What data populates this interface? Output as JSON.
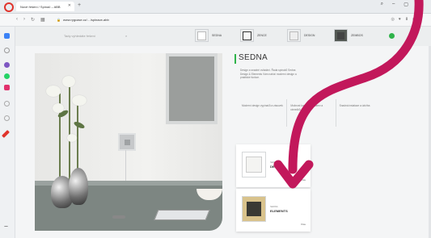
{
  "browser": {
    "tab_title": "Nové řešení / Spínač – ABB",
    "url": "www.rygcase.cz/…/spinace-abb",
    "colors": {
      "opera": "#e0342c"
    }
  },
  "site": {
    "search_placeholder": "Tady vyhledáte řešení",
    "products": [
      {
        "label": "SEDNA",
        "color": "#ffffff"
      },
      {
        "label": "ZENCE",
        "color": "#e6e6e6"
      },
      {
        "label": "DESIGN",
        "color": "#dcdcdc"
      },
      {
        "label": "ZEMBOS",
        "color": "#555a55"
      }
    ]
  },
  "content": {
    "title": "SEDNA",
    "description": "Design a snadné ovládání. Řada spínačů Sedna Design & Elements Vám nabízí moderní design a praktické funkce.",
    "features": [
      "Moderní design vypínačů a zásuvek",
      "Možnost kombinace barev a rámečků",
      "Snadná instalace a údržba"
    ],
    "cards": [
      {
        "label": "SEDNA",
        "name": "DESIGN",
        "more": "Více",
        "swatch": "#f4f4f2"
      },
      {
        "label": "SEDNA",
        "name": "ELEMENTS",
        "more": "Více",
        "swatch": "#3a3a34"
      }
    ]
  },
  "annotation": {
    "arrow_color": "#c2185b"
  }
}
